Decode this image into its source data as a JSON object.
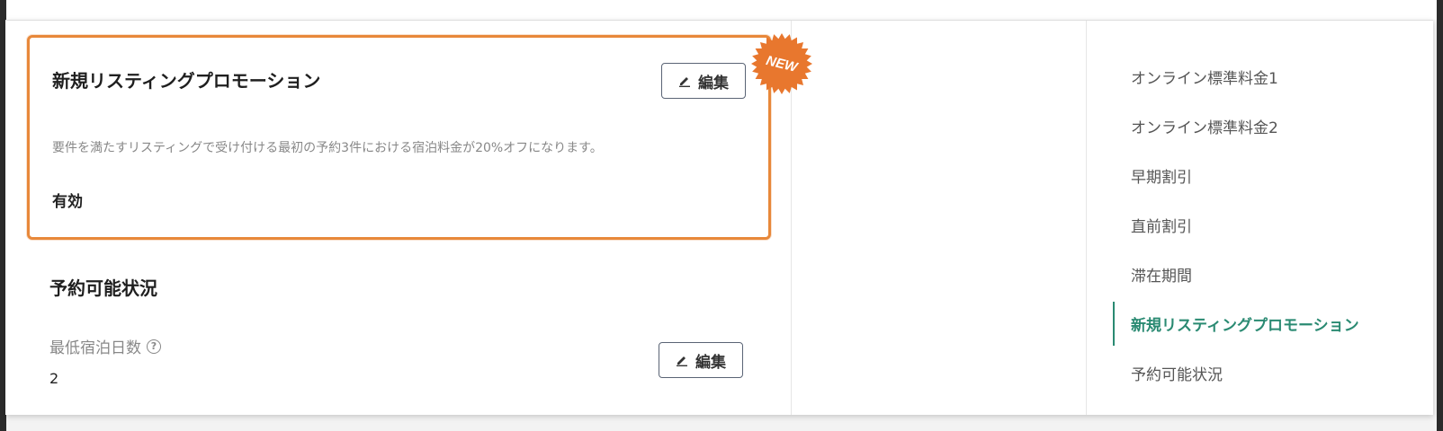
{
  "promo": {
    "title": "新規リスティングプロモーション",
    "edit_label": "編集",
    "description": "要件を満たすリスティングで受け付ける最初の予約3件における宿泊料金が20%オフになります。",
    "status": "有効",
    "badge": "NEW",
    "badge_color": "#e8772e",
    "border_color": "#e8883a"
  },
  "availability": {
    "title": "予約可能状況",
    "min_nights_label": "最低宿泊日数",
    "min_nights_value": "2",
    "edit_label": "編集",
    "help_icon": "question-circle-icon"
  },
  "nav": {
    "items": [
      {
        "label": "オンライン標準料金1"
      },
      {
        "label": "オンライン標準料金2"
      },
      {
        "label": "早期割引"
      },
      {
        "label": "直前割引"
      },
      {
        "label": "滞在期間"
      },
      {
        "label": "新規リスティングプロモーション"
      },
      {
        "label": "予約可能状況"
      }
    ],
    "active_index": 5,
    "accent_color": "#2a8a72"
  }
}
